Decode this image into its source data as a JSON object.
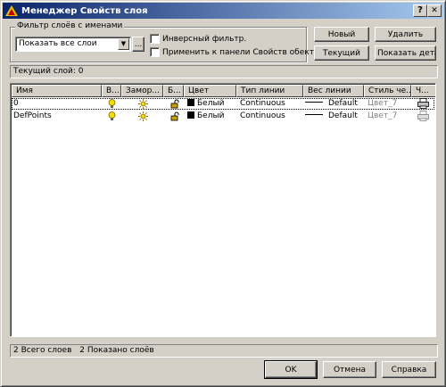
{
  "window": {
    "title": "Менеджер Свойств слоя",
    "help_button": "?",
    "close_button": "✕"
  },
  "filter": {
    "group_label": "Фильтр слоёв с именами",
    "combo_value": "Показать все слои",
    "dots_label": "...",
    "invert_label": "Инверсный фильтр.",
    "invert_checked": false,
    "apply_label": "Применить к панели Свойств обекта.",
    "apply_checked": false
  },
  "buttons": {
    "new": "Новый",
    "delete": "Удалить",
    "current": "Текущий",
    "show_details": "Показать детали"
  },
  "current_layer": {
    "label": "Текущий слой:",
    "value": "0"
  },
  "table": {
    "columns": [
      "Имя",
      "В...",
      "Замор...",
      "Б...",
      "Цвет",
      "Тип линии",
      "Вес линии",
      "Стиль че...",
      "Ч..."
    ],
    "rows": [
      {
        "name": "0",
        "on": "bulb-on",
        "freeze": "sun",
        "lock": "unlocked",
        "color": "Белый",
        "color_hex": "#000000",
        "linetype": "Continuous",
        "lineweight": "Default",
        "plot_style": "Цвет_7",
        "plot": "printer"
      },
      {
        "name": "DefPoints",
        "on": "bulb-on",
        "freeze": "sun",
        "lock": "unlocked",
        "color": "Белый",
        "color_hex": "#000000",
        "linetype": "Continuous",
        "lineweight": "Default",
        "plot_style": "Цвет_7",
        "plot": "printer-disabled"
      }
    ]
  },
  "status": {
    "total": "2 Всего слоев",
    "shown": "2 Показано слоёв"
  },
  "footer": {
    "ok": "OK",
    "cancel": "Отмена",
    "help": "Справка"
  },
  "colors": {
    "title_start": "#0a246a",
    "title_end": "#a6caf0",
    "face": "#d4d0c8",
    "bulb": "#f0e000",
    "sun": "#f0e000"
  }
}
